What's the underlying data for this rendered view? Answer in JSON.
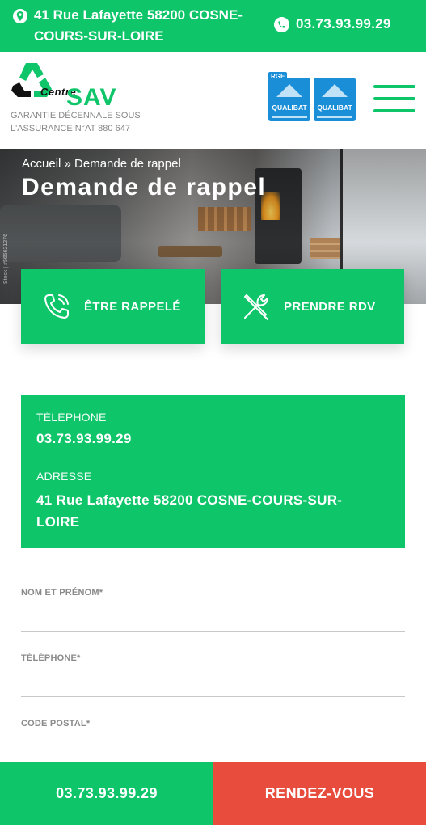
{
  "topbar": {
    "address": "41 Rue Lafayette 58200 COSNE-COURS-SUR-LOIRE",
    "phone": "03.73.93.99.29",
    "color": "#0fc56a"
  },
  "header": {
    "logo_centre": "Centre",
    "logo_sav": "SAV",
    "guarantee": "Garantie décennale sous l'assurance N°AT 880 647",
    "rge_tag": "RGE",
    "badges": [
      {
        "label": "QUALIBAT"
      },
      {
        "label": "QUALIBAT"
      }
    ],
    "menu_icon": "hamburger-menu-icon"
  },
  "hero": {
    "breadcrumb": "Accueil » Demande de rappel",
    "title": "Demande de rappel",
    "credit": "Stock | #565621276"
  },
  "actions": {
    "callback_label": "ÊTRE RAPPELÉ",
    "callback_icon": "phone-icon",
    "appointment_label": "PRENDRE RDV",
    "appointment_icon": "tools-icon"
  },
  "info": {
    "phone_label": "TÉLÉPHONE",
    "phone_value": "03.73.93.99.29",
    "address_label": "ADRESSE",
    "address_value": "41 Rue Lafayette 58200 COSNE-COURS-SUR-LOIRE"
  },
  "form": {
    "name_label": "NOM ET PRÉNOM*",
    "name_value": "",
    "phone_label": "TÉLÉPHONE*",
    "phone_value": "",
    "postal_label": "CODE POSTAL*",
    "postal_value": ""
  },
  "bottombar": {
    "phone": "03.73.93.99.29",
    "rdv": "RENDEZ-VOUS",
    "phone_color": "#0fc56a",
    "rdv_color": "#e74c3c"
  }
}
